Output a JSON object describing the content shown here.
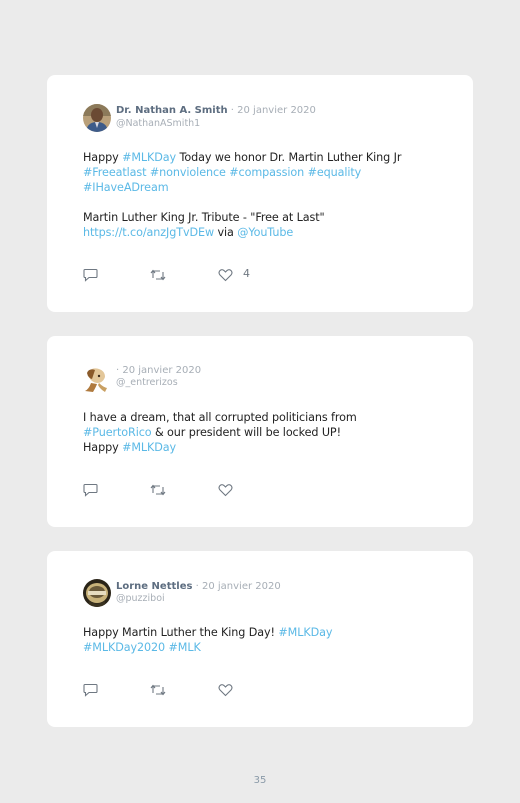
{
  "tweets": [
    {
      "author_name": "Dr. Nathan A. Smith",
      "date": "· 20 janvier 2020",
      "handle": "@NathanASmith1",
      "text_lines": [
        [
          {
            "t": "Happy ",
            "link": false
          },
          {
            "t": "#MLKDay",
            "link": true
          },
          {
            "t": " Today we honor Dr. Martin Luther King Jr",
            "link": false
          }
        ],
        [
          {
            "t": "#Freeatlast",
            "link": true
          },
          {
            "t": " ",
            "link": false
          },
          {
            "t": "#nonviolence",
            "link": true
          },
          {
            "t": " ",
            "link": false
          },
          {
            "t": "#compassion",
            "link": true
          },
          {
            "t": " ",
            "link": false
          },
          {
            "t": "#equality",
            "link": true
          }
        ],
        [
          {
            "t": "#IHaveADream",
            "link": true
          }
        ],
        [],
        [
          {
            "t": "Martin Luther King Jr. Tribute - \"Free at Last\"",
            "link": false
          }
        ],
        [
          {
            "t": "https://t.co/anzJgTvDEw",
            "link": true
          },
          {
            "t": " via ",
            "link": false
          },
          {
            "t": "@YouTube",
            "link": true
          }
        ]
      ],
      "like_count": "4"
    },
    {
      "author_name": "",
      "date": "· 20 janvier 2020",
      "handle": "@_entrerizos",
      "text_lines": [
        [
          {
            "t": "I have a dream, that all corrupted politicians from",
            "link": false
          }
        ],
        [
          {
            "t": "#PuertoRico",
            "link": true
          },
          {
            "t": " & our president will be locked UP!",
            "link": false
          }
        ],
        [
          {
            "t": "Happy ",
            "link": false
          },
          {
            "t": "#MLKDay",
            "link": true
          }
        ]
      ],
      "like_count": ""
    },
    {
      "author_name": "Lorne Nettles",
      "date": "· 20 janvier 2020",
      "handle": "@puzziboi",
      "text_lines": [
        [
          {
            "t": "Happy Martin Luther the King Day! ",
            "link": false
          },
          {
            "t": "#MLKDay",
            "link": true
          }
        ],
        [
          {
            "t": "#MLKDay2020",
            "link": true
          },
          {
            "t": " ",
            "link": false
          },
          {
            "t": "#MLK",
            "link": true
          }
        ]
      ],
      "like_count": ""
    }
  ],
  "icons": {
    "reply": "reply-icon",
    "retweet": "retweet-icon",
    "like": "heart-icon"
  },
  "colors": {
    "link": "#5bb9e6",
    "name": "#5d6d80",
    "meta": "#a7aeb6",
    "icon": "#6f7882",
    "background": "#ebebeb"
  },
  "page_number": "35"
}
